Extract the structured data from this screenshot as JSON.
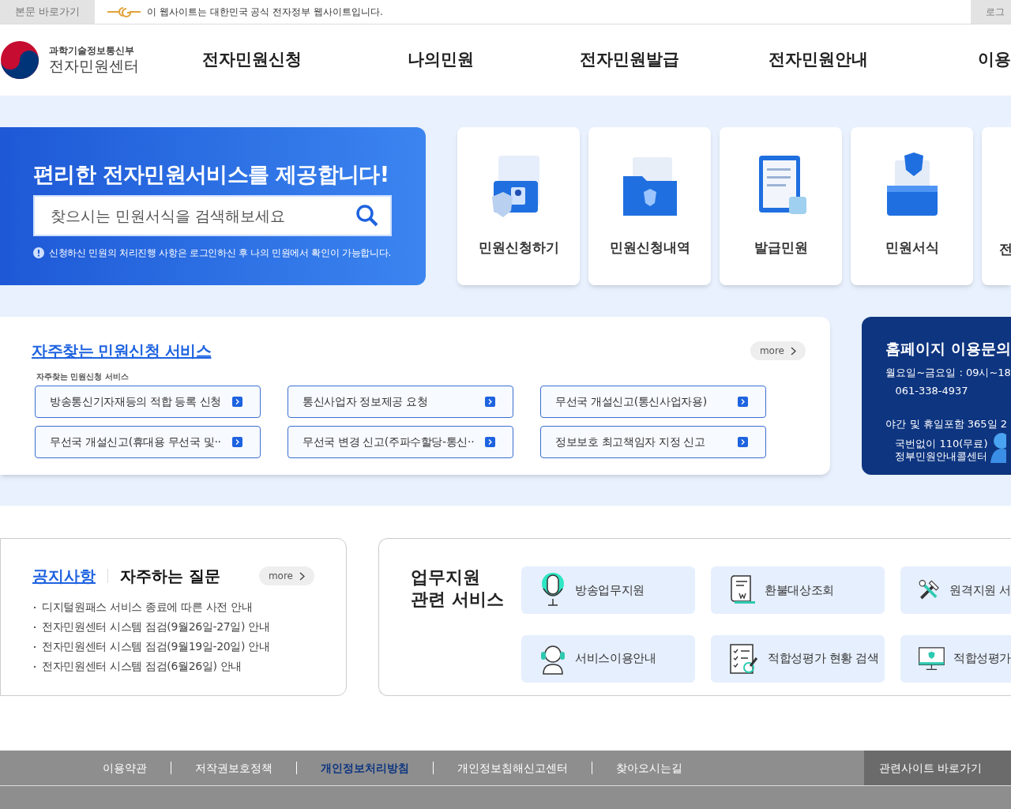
{
  "skip_link": "본문 바로가기",
  "gov_notice": "이 웹사이트는 대한민국 공식 전자정부 웹사이트입니다.",
  "login": "로그",
  "logo": {
    "ministry": "과학기술정보통신부",
    "center": "전자민원센터"
  },
  "nav": [
    "전자민원신청",
    "나의민원",
    "전자민원발급",
    "전자민원안내",
    "이용"
  ],
  "hero": {
    "title": "편리한 전자민원서비스를 제공합니다!",
    "search": {
      "placeholder": "찾으시는 민원서식을 검색해보세요"
    },
    "notice": "신청하신 민원의 처리진행 사항은 로그인하신 후 나의 민원에서 확인이 가능합니다."
  },
  "quick_tiles": [
    {
      "label": "민원신청하기",
      "kind": "document"
    },
    {
      "label": "민원신청내역",
      "kind": "folder"
    },
    {
      "label": "발급민원",
      "kind": "clipboard"
    },
    {
      "label": "민원서식",
      "kind": "box"
    },
    {
      "label": "전",
      "kind": "partial"
    }
  ],
  "frequent": {
    "title": "자주찾는 민원신청 서비스",
    "more": "more",
    "caption": "자주찾는 민원신청 서비스",
    "items": [
      "방송통신기자재등의 적합 등록 신청",
      "통신사업자 정보제공 요청",
      "무선국 개설신고(통신사업자용)",
      "무선국 개설신고(휴대용 무선국 및··",
      "무선국 변경 신고(주파수할당-통신··",
      "정보보호 최고책임자 지정 신고"
    ]
  },
  "contact": {
    "title": "홈페이지 이용문의",
    "hours": "월요일~금요일 : 09시~18",
    "phone": "061-338-4937",
    "night": "야간 및 휴일포함 365일 2",
    "line1": "국번없이 110(무료)",
    "line2": "정부민원안내콜센터"
  },
  "notices": {
    "tabs": [
      {
        "label": "공지사항",
        "selected": true
      },
      {
        "label": "자주하는 질문",
        "selected": false
      }
    ],
    "more": "more",
    "items": [
      "디지털원패스 서비스 종료에 따른 사전 안내",
      "전자민원센터 시스템 점검(9월26일-27일) 안내",
      "전자민원센터 시스템 점검(9월19일-20일) 안내",
      "전자민원센터 시스템 점검(6월26일) 안내"
    ]
  },
  "services": {
    "title_lines": [
      "업무지원",
      "관련 서비스"
    ],
    "items": [
      {
        "label": "방송업무지원",
        "kind": "microphone"
      },
      {
        "label": "환불대상조회",
        "kind": "receipt"
      },
      {
        "label": "원격지원 서",
        "kind": "tools"
      },
      {
        "label": "서비스이용안내",
        "kind": "headset"
      },
      {
        "label": "적합성평가 현황 검색",
        "kind": "checklist"
      },
      {
        "label": "적합성평가",
        "kind": "monitor"
      }
    ]
  },
  "footer": {
    "links": [
      {
        "label": "이용약관",
        "highlighted": false
      },
      {
        "label": "저작권보호정책",
        "highlighted": false
      },
      {
        "label": "개인정보처리방침",
        "highlighted": true
      },
      {
        "label": "개인정보침해신고센터",
        "highlighted": false
      },
      {
        "label": "찾아오시는길",
        "highlighted": false
      }
    ],
    "related": "관련사이트 바로가기"
  }
}
